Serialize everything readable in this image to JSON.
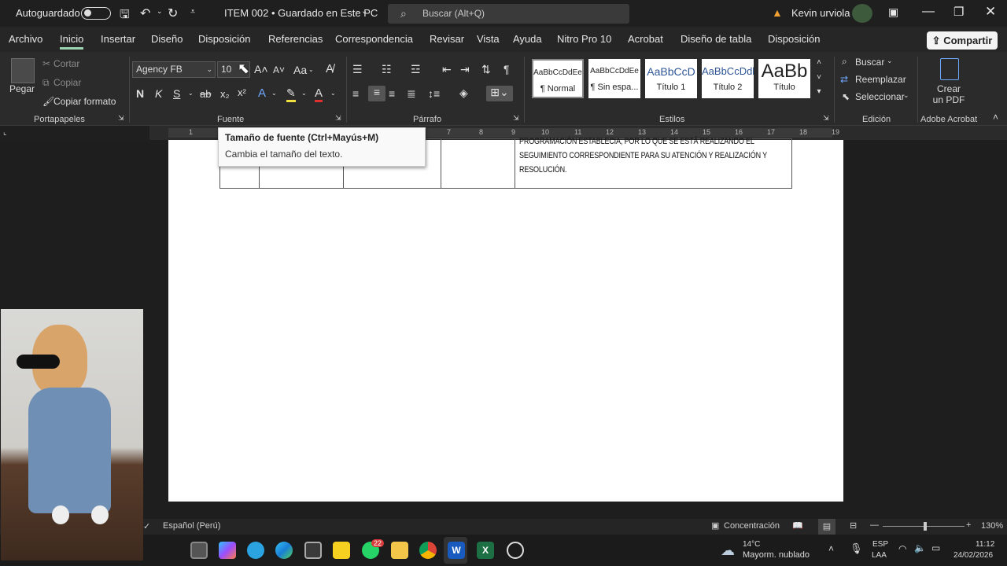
{
  "titlebar": {
    "autosave": "Autoguardado",
    "doc_title": "ITEM 002 • Guardado en Este PC",
    "search_placeholder": "Buscar (Alt+Q)",
    "user": "Kevin urviola"
  },
  "menu": {
    "tabs": [
      "Archivo",
      "Inicio",
      "Insertar",
      "Diseño",
      "Disposición",
      "Referencias",
      "Correspondencia",
      "Revisar",
      "Vista",
      "Ayuda",
      "Nitro Pro 10",
      "Acrobat",
      "Diseño de tabla",
      "Disposición"
    ],
    "active": "Inicio",
    "share": "Compartir"
  },
  "ribbon": {
    "clipboard": {
      "paste": "Pegar",
      "cut": "Cortar",
      "copy": "Copiar",
      "format_painter": "Copiar formato",
      "label": "Portapapeles"
    },
    "font": {
      "family": "Agency FB",
      "size": "10",
      "label": "Fuente",
      "case": "Aa",
      "bold": "N",
      "italic": "K",
      "underline": "S",
      "strike": "ab"
    },
    "paragraph": {
      "label": "Párrafo"
    },
    "styles": {
      "label": "Estilos",
      "items": [
        {
          "preview": "AaBbCcDdEe",
          "name": "¶ Normal"
        },
        {
          "preview": "AaBbCcDdEe",
          "name": "¶ Sin espa..."
        },
        {
          "preview": "AaBbCcD",
          "name": "Título 1"
        },
        {
          "preview": "AaBbCcDdl",
          "name": "Título 2"
        },
        {
          "preview": "AaBb",
          "name": "Título"
        }
      ]
    },
    "editing": {
      "label": "Edición",
      "find": "Buscar",
      "replace": "Reemplazar",
      "select": "Seleccionar"
    },
    "acrobat": {
      "label": "Adobe Acrobat",
      "create_pdf": "Crear un PDF"
    }
  },
  "ruler": {
    "ticks": [
      "1",
      "7",
      "8",
      "9",
      "10",
      "11",
      "12",
      "13",
      "14",
      "15",
      "16",
      "17",
      "18",
      "19"
    ]
  },
  "tooltip": {
    "title": "Tamaño de fuente (Ctrl+Mayús+M)",
    "body": "Cambia el tamaño del texto."
  },
  "document": {
    "lines": [
      "PROGRAMACIÓN ESTABLECIA, POR LO QUE SE ESTÁ REALIZANDO EL",
      "SEGUIMIENTO CORRESPONDIENTE PARA SU ATENCIÓN Y REALIZACIÓN Y",
      "RESOLUCIÓN."
    ]
  },
  "statusbar": {
    "language": "Español (Perú)",
    "focus": "Concentración",
    "zoom": "130%"
  },
  "taskbar": {
    "weather_temp": "14°C",
    "weather_desc": "Mayorm. nublado",
    "lang1": "ESP",
    "lang2": "LAA",
    "time": "11:12",
    "date": "24/02/2026",
    "whatsapp_badge": "22"
  },
  "colors": {
    "accent": "#9cd4b4",
    "word_blue": "#185abd",
    "excel_green": "#1d7044"
  }
}
